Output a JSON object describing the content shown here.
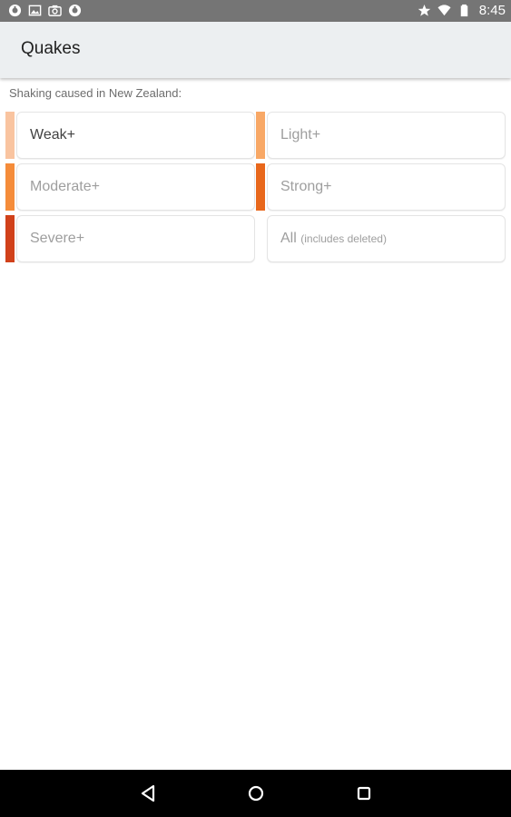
{
  "status_bar": {
    "left_icons": [
      "app-notification-icon",
      "image-icon",
      "camera-icon",
      "app-notification-icon"
    ],
    "right_icons": [
      "star-icon",
      "wifi-icon",
      "battery-icon"
    ],
    "time": "8:45"
  },
  "app_bar": {
    "title": "Quakes"
  },
  "main": {
    "section_label": "Shaking caused in New Zealand:",
    "filters": [
      {
        "label": "Weak+",
        "note": "",
        "color": "#f9c4a0",
        "selected": true
      },
      {
        "label": "Light+",
        "note": "",
        "color": "#f8a866",
        "selected": false
      },
      {
        "label": "Moderate+",
        "note": "",
        "color": "#f58c3a",
        "selected": false
      },
      {
        "label": "Strong+",
        "note": "",
        "color": "#e8671b",
        "selected": false
      },
      {
        "label": "Severe+",
        "note": "",
        "color": "#d1411a",
        "selected": false
      },
      {
        "label": "All",
        "note": "(includes deleted)",
        "color": "",
        "selected": false
      }
    ]
  },
  "nav_bar": {
    "buttons": [
      "back-icon",
      "home-icon",
      "recents-icon"
    ]
  }
}
